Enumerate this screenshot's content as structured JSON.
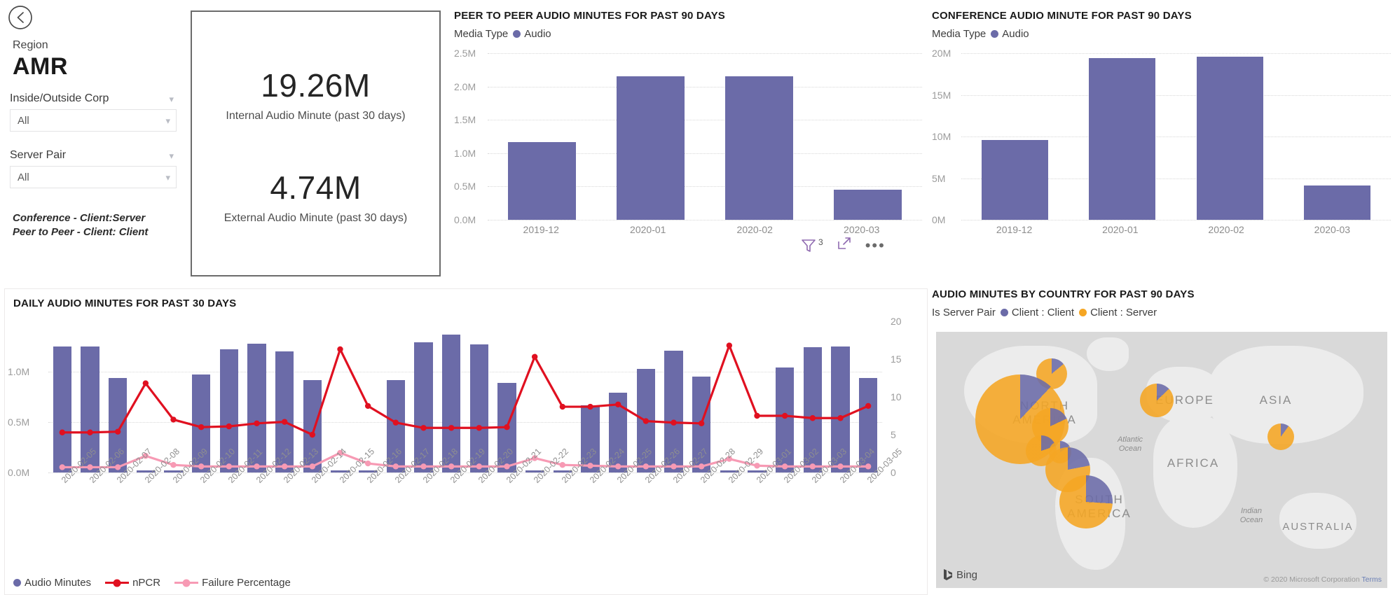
{
  "nav": {
    "back_icon": "back-arrow-icon"
  },
  "filters": {
    "region_label": "Region",
    "region_value": "AMR",
    "slicers": [
      {
        "title": "Inside/Outside Corp",
        "value": "All"
      },
      {
        "title": "Server Pair",
        "value": "All"
      }
    ],
    "note_line1": "Conference - Client:Server",
    "note_line2": "Peer to Peer - Client: Client"
  },
  "kpi": {
    "internal_value": "19.26M",
    "internal_label": "Internal Audio Minute (past 30 days)",
    "external_value": "4.74M",
    "external_label": "External Audio Minute (past 30 days)"
  },
  "peer_chart": {
    "title": "PEER TO PEER AUDIO MINUTES FOR PAST 90 DAYS",
    "legend_title": "Media Type",
    "legend_series": "Audio",
    "footer": {
      "filter_count": "3",
      "filter_icon": "filter-icon",
      "focus_icon": "focus-mode-icon",
      "more_icon": "more-options-icon"
    }
  },
  "conference_chart": {
    "title": "CONFERENCE AUDIO MINUTE FOR PAST 90 DAYS",
    "legend_title": "Media Type",
    "legend_series": "Audio"
  },
  "daily_chart": {
    "title": "DAILY AUDIO MINUTES FOR PAST 30 DAYS",
    "legend": [
      {
        "label": "Audio Minutes",
        "kind": "dot"
      },
      {
        "label": "nPCR",
        "kind": "line"
      },
      {
        "label": "Failure Percentage",
        "kind": "line"
      }
    ]
  },
  "map_chart": {
    "title": "AUDIO MINUTES BY COUNTRY FOR PAST 90 DAYS",
    "legend_title": "Is Server Pair",
    "legend_items": [
      {
        "label": "Client : Client",
        "color": "#6b6ba8"
      },
      {
        "label": "Client : Server",
        "color": "#f5a623"
      }
    ],
    "provider": "Bing",
    "attribution": "© 2020 Microsoft Corporation",
    "attribution_link": "Terms",
    "continent_labels": [
      "NORTH AMERICA",
      "SOUTH AMERICA",
      "EUROPE",
      "ASIA",
      "AFRICA",
      "AUSTRALIA"
    ],
    "ocean_labels": [
      "Atlantic Ocean",
      "Indian Ocean"
    ],
    "yticks": [
      "20",
      "15",
      "10",
      "5",
      "0"
    ]
  },
  "colors": {
    "bar": "#6b6ba8",
    "npcr_line": "#e01020",
    "failure_line": "#f79ab4",
    "client_server": "#f5a623",
    "grid": "#d8d8d8"
  },
  "chart_data": [
    {
      "type": "bar",
      "id": "peer_to_peer",
      "title": "PEER TO PEER AUDIO MINUTES FOR PAST 90 DAYS",
      "categories": [
        "2019-12",
        "2020-01",
        "2020-02",
        "2020-03"
      ],
      "values": [
        1.17,
        2.15,
        2.15,
        0.45
      ],
      "series_name": "Audio",
      "ylabel": "",
      "xlabel": "",
      "ylim": [
        0,
        2.5
      ],
      "yticks": [
        0,
        0.5,
        1.0,
        1.5,
        2.0,
        2.5
      ],
      "ytick_labels": [
        "0.0M",
        "0.5M",
        "1.0M",
        "1.5M",
        "2.0M",
        "2.5M"
      ],
      "grid": true,
      "legend_position": "top"
    },
    {
      "type": "bar",
      "id": "conference",
      "title": "CONFERENCE AUDIO MINUTE FOR PAST 90 DAYS",
      "categories": [
        "2019-12",
        "2020-01",
        "2020-02",
        "2020-03"
      ],
      "values": [
        9.6,
        19.4,
        19.6,
        4.1
      ],
      "series_name": "Audio",
      "ylabel": "",
      "xlabel": "",
      "ylim": [
        0,
        20
      ],
      "yticks": [
        0,
        5,
        10,
        15,
        20
      ],
      "ytick_labels": [
        "0M",
        "5M",
        "10M",
        "15M",
        "20M"
      ],
      "grid": true,
      "legend_position": "top"
    },
    {
      "type": "bar",
      "id": "daily_audio_minutes",
      "title": "DAILY AUDIO MINUTES FOR PAST 30 DAYS",
      "categories": [
        "2020-02-05",
        "2020-02-06",
        "2020-02-07",
        "2020-02-08",
        "2020-02-09",
        "2020-02-10",
        "2020-02-11",
        "2020-02-12",
        "2020-02-13",
        "2020-02-14",
        "2020-02-15",
        "2020-02-16",
        "2020-02-17",
        "2020-02-18",
        "2020-02-19",
        "2020-02-20",
        "2020-02-21",
        "2020-02-22",
        "2020-02-23",
        "2020-02-24",
        "2020-02-25",
        "2020-02-26",
        "2020-02-27",
        "2020-02-28",
        "2020-02-29",
        "2020-03-01",
        "2020-03-02",
        "2020-03-03",
        "2020-03-04",
        "2020-03-05"
      ],
      "ylim": [
        0,
        1.5
      ],
      "yticks": [
        0,
        0.5,
        1.0
      ],
      "ytick_labels": [
        "0.0M",
        "0.5M",
        "1.0M"
      ],
      "y2lim": [
        0,
        20
      ],
      "grid": true,
      "legend_position": "bottom",
      "series": [
        {
          "name": "Audio Minutes",
          "type": "bar",
          "axis": "left",
          "values": [
            1.25,
            1.25,
            0.94,
            0.02,
            0.02,
            0.97,
            1.22,
            1.28,
            1.2,
            0.92,
            0.02,
            0.02,
            0.92,
            1.29,
            1.37,
            1.27,
            0.89,
            0.02,
            0.02,
            0.67,
            0.79,
            1.03,
            1.21,
            0.95,
            0.02,
            0.02,
            1.04,
            1.24,
            1.25,
            0.94
          ]
        },
        {
          "name": "nPCR",
          "type": "line",
          "axis": "right",
          "values": [
            5.3,
            5.3,
            5.4,
            11.8,
            7.0,
            6.0,
            6.1,
            6.5,
            6.7,
            5.0,
            16.3,
            8.8,
            6.6,
            5.9,
            5.9,
            5.9,
            6.0,
            15.3,
            8.7,
            8.7,
            9.0,
            6.8,
            6.6,
            6.5,
            16.8,
            7.5,
            7.5,
            7.2,
            7.2,
            8.8
          ]
        },
        {
          "name": "Failure Percentage",
          "type": "line",
          "axis": "right",
          "values": [
            0.7,
            0.7,
            0.7,
            2.2,
            1.0,
            0.8,
            0.8,
            0.8,
            0.8,
            0.8,
            2.6,
            1.2,
            0.8,
            0.8,
            0.8,
            0.8,
            0.8,
            1.9,
            1.0,
            0.9,
            0.8,
            0.8,
            0.8,
            0.8,
            1.8,
            0.9,
            0.8,
            0.8,
            0.8,
            0.8
          ]
        }
      ]
    },
    {
      "type": "scatter",
      "id": "audio_minutes_by_country_map",
      "title": "AUDIO MINUTES BY COUNTRY FOR PAST 90 DAYS",
      "legend_title": "Is Server Pair",
      "series": [
        {
          "name": "Client : Client",
          "color": "#6b6ba8"
        },
        {
          "name": "Client : Server",
          "color": "#f5a623"
        }
      ],
      "bubbles": [
        {
          "x": 165,
          "y": 60,
          "r": 22,
          "client_client_pct": 14
        },
        {
          "x": 120,
          "y": 125,
          "r": 64,
          "client_client_pct": 12
        },
        {
          "x": 163,
          "y": 135,
          "r": 26,
          "client_client_pct": 18
        },
        {
          "x": 150,
          "y": 170,
          "r": 22,
          "client_client_pct": 20
        },
        {
          "x": 177,
          "y": 172,
          "r": 16,
          "client_client_pct": 16
        },
        {
          "x": 188,
          "y": 197,
          "r": 32,
          "client_client_pct": 22
        },
        {
          "x": 214,
          "y": 243,
          "r": 38,
          "client_client_pct": 26
        },
        {
          "x": 315,
          "y": 98,
          "r": 24,
          "client_client_pct": 13
        },
        {
          "x": 492,
          "y": 150,
          "r": 19,
          "client_client_pct": 10
        }
      ]
    }
  ]
}
